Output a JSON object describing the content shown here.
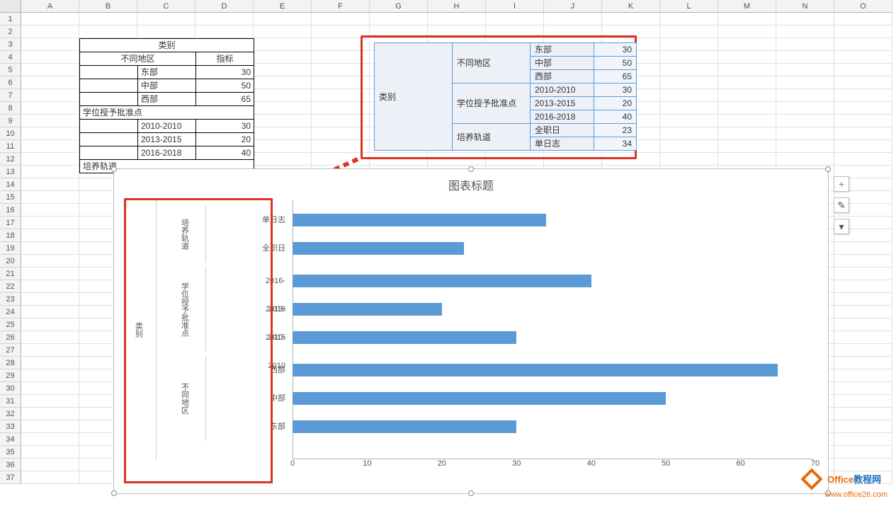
{
  "columns": [
    "A",
    "B",
    "C",
    "D",
    "E",
    "F",
    "G",
    "H",
    "I",
    "J",
    "K",
    "L",
    "M",
    "N",
    "O"
  ],
  "row_count": 37,
  "source_table": {
    "header1": "类别",
    "header2_left": "不同地区",
    "header2_right": "指标",
    "groups": [
      {
        "name": "",
        "sub": "东部",
        "val": "30"
      },
      {
        "name": "",
        "sub": "中部",
        "val": "50"
      },
      {
        "name": "",
        "sub": "西部",
        "val": "65"
      },
      {
        "name": "学位授予批准点",
        "sub": "",
        "val": ""
      },
      {
        "name": "",
        "sub": "2010-2010",
        "val": "30"
      },
      {
        "name": "",
        "sub": "2013-2015",
        "val": "20"
      },
      {
        "name": "",
        "sub": "2016-2018",
        "val": "40"
      },
      {
        "name": "培养轨道",
        "sub": "",
        "val": ""
      }
    ]
  },
  "blue_table": {
    "root": "类别",
    "rows": [
      {
        "g1": "不同地区",
        "g2": "东部",
        "v": "30"
      },
      {
        "g1": "",
        "g2": "中部",
        "v": "50"
      },
      {
        "g1": "",
        "g2": "西部",
        "v": "65"
      },
      {
        "g1": "学位授予批准点",
        "g2": "2010-2010",
        "v": "30"
      },
      {
        "g1": "",
        "g2": "2013-2015",
        "v": "20"
      },
      {
        "g1": "",
        "g2": "2016-2018",
        "v": "40"
      },
      {
        "g1": "培养轨道",
        "g2": "全职日",
        "v": "23"
      },
      {
        "g1": "",
        "g2": "单日志",
        "v": "34"
      }
    ]
  },
  "chart_data": {
    "type": "bar",
    "orientation": "horizontal",
    "title": "图表标题",
    "xlabel": "",
    "ylabel": "",
    "xlim": [
      0,
      70
    ],
    "xticks": [
      0,
      10,
      20,
      30,
      40,
      50,
      60,
      70
    ],
    "outer_category": "类别",
    "groups": [
      {
        "name": "培养轨道",
        "items": [
          {
            "label": "单日志",
            "value": 34
          },
          {
            "label": "全职日",
            "value": 23
          }
        ]
      },
      {
        "name": "学位授予批准点",
        "items": [
          {
            "label": "2016-2018",
            "value": 40
          },
          {
            "label": "2013-2015",
            "value": 20
          },
          {
            "label": "2010-2010",
            "value": 30
          }
        ]
      },
      {
        "name": "不同地区",
        "items": [
          {
            "label": "西部",
            "value": 65
          },
          {
            "label": "中部",
            "value": 50
          },
          {
            "label": "东部",
            "value": 30
          }
        ]
      }
    ],
    "bar_color": "#5b9bd5"
  },
  "watermark": {
    "line1_a": "Office",
    "line1_b": "教程网",
    "line2": "www.office26.com"
  },
  "chart_buttons": {
    "add": "+",
    "brush": "✎",
    "filter": "▾"
  }
}
